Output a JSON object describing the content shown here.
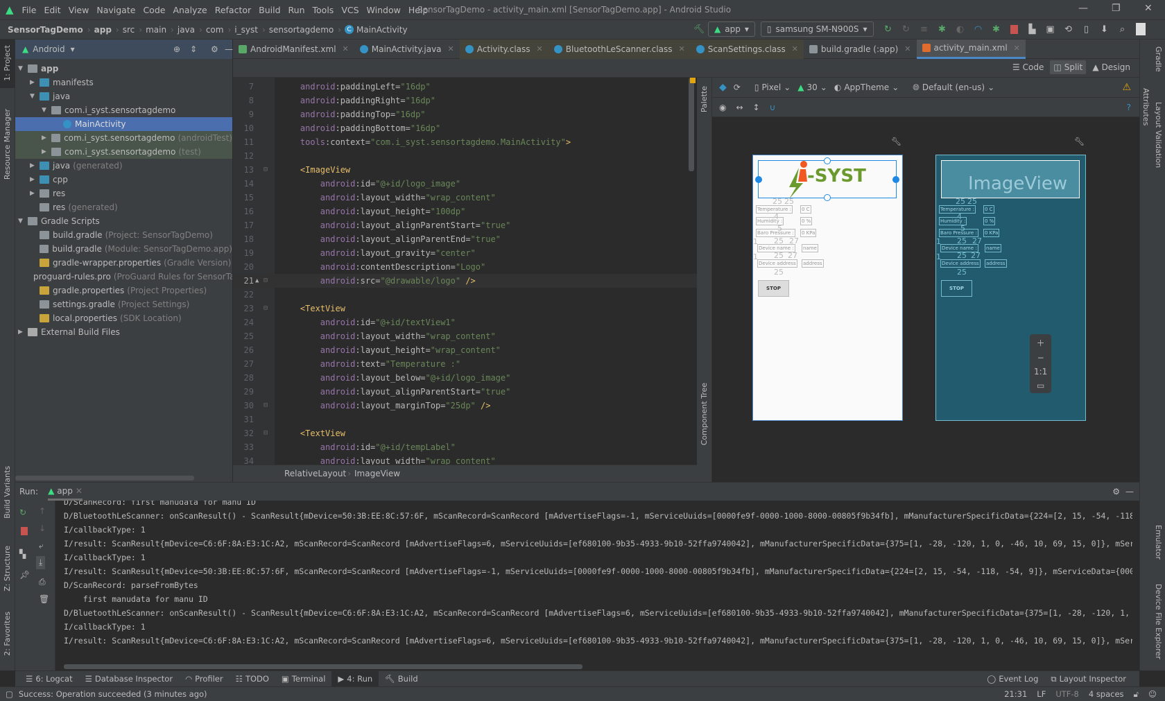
{
  "window": {
    "title": "SensorTagDemo - activity_main.xml [SensorTagDemo.app] - Android Studio"
  },
  "menu": [
    "File",
    "Edit",
    "View",
    "Navigate",
    "Code",
    "Analyze",
    "Refactor",
    "Build",
    "Run",
    "Tools",
    "VCS",
    "Window",
    "Help"
  ],
  "breadcrumb": [
    "SensorTagDemo",
    "app",
    "src",
    "main",
    "java",
    "com",
    "i_syst",
    "sensortagdemo",
    "MainActivity"
  ],
  "toolbar": {
    "run_config": "app",
    "device": "samsung SM-N900S"
  },
  "project": {
    "view_label": "Android",
    "items": [
      {
        "label": "app",
        "hint": "",
        "depth": 0,
        "arrow": "down",
        "icon": "module-folder",
        "bold": true
      },
      {
        "label": "manifests",
        "hint": "",
        "depth": 1,
        "arrow": "right",
        "icon": "folder"
      },
      {
        "label": "java",
        "hint": "",
        "depth": 1,
        "arrow": "down",
        "icon": "folder"
      },
      {
        "label": "com.i_syst.sensortagdemo",
        "hint": "",
        "depth": 2,
        "arrow": "down",
        "icon": "package"
      },
      {
        "label": "MainActivity",
        "hint": "",
        "depth": 3,
        "arrow": "",
        "icon": "class",
        "state": "sel"
      },
      {
        "label": "com.i_syst.sensortagdemo",
        "hint": "(androidTest)",
        "depth": 2,
        "arrow": "right",
        "icon": "package",
        "state": "test"
      },
      {
        "label": "com.i_syst.sensortagdemo",
        "hint": "(test)",
        "depth": 2,
        "arrow": "right",
        "icon": "package",
        "state": "test"
      },
      {
        "label": "java",
        "hint": "(generated)",
        "depth": 1,
        "arrow": "right",
        "icon": "folder"
      },
      {
        "label": "cpp",
        "hint": "",
        "depth": 1,
        "arrow": "right",
        "icon": "folder"
      },
      {
        "label": "res",
        "hint": "",
        "depth": 1,
        "arrow": "right",
        "icon": "res-folder"
      },
      {
        "label": "res",
        "hint": "(generated)",
        "depth": 1,
        "arrow": "",
        "icon": "res-folder"
      },
      {
        "label": "Gradle Scripts",
        "hint": "",
        "depth": 0,
        "arrow": "down",
        "icon": "gradle"
      },
      {
        "label": "build.gradle",
        "hint": "(Project: SensorTagDemo)",
        "depth": 1,
        "arrow": "",
        "icon": "gradle"
      },
      {
        "label": "build.gradle",
        "hint": "(Module: SensorTagDemo.app)",
        "depth": 1,
        "arrow": "",
        "icon": "gradle"
      },
      {
        "label": "gradle-wrapper.properties",
        "hint": "(Gradle Version)",
        "depth": 1,
        "arrow": "",
        "icon": "properties"
      },
      {
        "label": "proguard-rules.pro",
        "hint": "(ProGuard Rules for SensorTa",
        "depth": 1,
        "arrow": "",
        "icon": "file"
      },
      {
        "label": "gradle.properties",
        "hint": "(Project Properties)",
        "depth": 1,
        "arrow": "",
        "icon": "properties"
      },
      {
        "label": "settings.gradle",
        "hint": "(Project Settings)",
        "depth": 1,
        "arrow": "",
        "icon": "gradle"
      },
      {
        "label": "local.properties",
        "hint": "(SDK Location)",
        "depth": 1,
        "arrow": "",
        "icon": "properties"
      },
      {
        "label": "External Build Files",
        "hint": "",
        "depth": 0,
        "arrow": "right",
        "icon": "tools"
      }
    ]
  },
  "tabs": [
    {
      "label": "AndroidManifest.xml",
      "icon": "manifest"
    },
    {
      "label": "MainActivity.java",
      "icon": "class"
    },
    {
      "label": "Activity.class",
      "icon": "class-lib",
      "lib": true
    },
    {
      "label": "BluetoothLeScanner.class",
      "icon": "class-lib",
      "lib": true
    },
    {
      "label": "ScanSettings.class",
      "icon": "class-lib",
      "lib": true
    },
    {
      "label": "build.gradle (:app)",
      "icon": "gradle"
    },
    {
      "label": "activity_main.xml",
      "icon": "layout-xml",
      "active": true
    }
  ],
  "view_modes": [
    "Code",
    "Split",
    "Design"
  ],
  "active_view_mode": "Split",
  "editor": {
    "current_line": 21,
    "lines": [
      {
        "n": 7,
        "seg": [
          [
            "ns",
            "    android"
          ],
          [
            "at",
            ":paddingLeft="
          ],
          [
            "str",
            "\"16dp\""
          ]
        ]
      },
      {
        "n": 8,
        "seg": [
          [
            "ns",
            "    android"
          ],
          [
            "at",
            ":paddingRight="
          ],
          [
            "str",
            "\"16dp\""
          ]
        ]
      },
      {
        "n": 9,
        "seg": [
          [
            "ns",
            "    android"
          ],
          [
            "at",
            ":paddingTop="
          ],
          [
            "str",
            "\"16dp\""
          ]
        ]
      },
      {
        "n": 10,
        "seg": [
          [
            "ns",
            "    android"
          ],
          [
            "at",
            ":paddingBottom="
          ],
          [
            "str",
            "\"16dp\""
          ]
        ]
      },
      {
        "n": 11,
        "seg": [
          [
            "ns",
            "    tools"
          ],
          [
            "at",
            ":context="
          ],
          [
            "str",
            "\"com.i_syst.sensortagdemo.MainActivity\""
          ],
          [
            "tag",
            ">"
          ]
        ]
      },
      {
        "n": 12,
        "seg": []
      },
      {
        "n": 13,
        "seg": [
          [
            "tag",
            "    <ImageView"
          ]
        ]
      },
      {
        "n": 14,
        "seg": [
          [
            "ns",
            "        android"
          ],
          [
            "at",
            ":id="
          ],
          [
            "str",
            "\"@+id/logo_image\""
          ]
        ]
      },
      {
        "n": 15,
        "seg": [
          [
            "ns",
            "        android"
          ],
          [
            "at",
            ":layout_width="
          ],
          [
            "str",
            "\"wrap_content\""
          ]
        ]
      },
      {
        "n": 16,
        "seg": [
          [
            "ns",
            "        android"
          ],
          [
            "at",
            ":layout_height="
          ],
          [
            "str",
            "\"100dp\""
          ]
        ]
      },
      {
        "n": 17,
        "seg": [
          [
            "ns",
            "        android"
          ],
          [
            "at",
            ":layout_alignParentStart="
          ],
          [
            "str",
            "\"true\""
          ]
        ]
      },
      {
        "n": 18,
        "seg": [
          [
            "ns",
            "        android"
          ],
          [
            "at",
            ":layout_alignParentEnd="
          ],
          [
            "str",
            "\"true\""
          ]
        ]
      },
      {
        "n": 19,
        "seg": [
          [
            "ns",
            "        android"
          ],
          [
            "at",
            ":layout_gravity="
          ],
          [
            "str",
            "\"center\""
          ]
        ]
      },
      {
        "n": 20,
        "seg": [
          [
            "ns",
            "        android"
          ],
          [
            "at",
            ":contentDescription="
          ],
          [
            "str",
            "\"Logo\""
          ]
        ]
      },
      {
        "n": 21,
        "seg": [
          [
            "ns",
            "        android"
          ],
          [
            "at",
            ":src="
          ],
          [
            "str",
            "\"@drawable/logo\""
          ],
          [
            "tag",
            " />"
          ]
        ]
      },
      {
        "n": 22,
        "seg": []
      },
      {
        "n": 23,
        "seg": [
          [
            "tag",
            "    <TextView"
          ]
        ]
      },
      {
        "n": 24,
        "seg": [
          [
            "ns",
            "        android"
          ],
          [
            "at",
            ":id="
          ],
          [
            "str",
            "\"@+id/textView1\""
          ]
        ]
      },
      {
        "n": 25,
        "seg": [
          [
            "ns",
            "        android"
          ],
          [
            "at",
            ":layout_width="
          ],
          [
            "str",
            "\"wrap_content\""
          ]
        ]
      },
      {
        "n": 26,
        "seg": [
          [
            "ns",
            "        android"
          ],
          [
            "at",
            ":layout_height="
          ],
          [
            "str",
            "\"wrap_content\""
          ]
        ]
      },
      {
        "n": 27,
        "seg": [
          [
            "ns",
            "        android"
          ],
          [
            "at",
            ":text="
          ],
          [
            "str",
            "\"Temperature :\""
          ]
        ]
      },
      {
        "n": 28,
        "seg": [
          [
            "ns",
            "        android"
          ],
          [
            "at",
            ":layout_below="
          ],
          [
            "str",
            "\"@+id/logo_image\""
          ]
        ]
      },
      {
        "n": 29,
        "seg": [
          [
            "ns",
            "        android"
          ],
          [
            "at",
            ":layout_alignParentStart="
          ],
          [
            "str",
            "\"true\""
          ]
        ]
      },
      {
        "n": 30,
        "seg": [
          [
            "ns",
            "        android"
          ],
          [
            "at",
            ":layout_marginTop="
          ],
          [
            "str",
            "\"25dp\""
          ],
          [
            "tag",
            " />"
          ]
        ]
      },
      {
        "n": 31,
        "seg": []
      },
      {
        "n": 32,
        "seg": [
          [
            "tag",
            "    <TextView"
          ]
        ]
      },
      {
        "n": 33,
        "seg": [
          [
            "ns",
            "        android"
          ],
          [
            "at",
            ":id="
          ],
          [
            "str",
            "\"@+id/tempLabel\""
          ]
        ]
      },
      {
        "n": 34,
        "seg": [
          [
            "ns",
            "        android"
          ],
          [
            "at",
            ":layout_width="
          ],
          [
            "str",
            "\"wrap_content\""
          ]
        ]
      }
    ]
  },
  "editor_breadcrumb": [
    "RelativeLayout",
    "ImageView"
  ],
  "design": {
    "palette_label": "Palette",
    "component_tree_label": "Component Tree",
    "device": "Pixel",
    "api": "30",
    "theme": "AppTheme",
    "locale": "Default (en-us)",
    "logo_text": "i-SYST",
    "imageview_label": "ImageView",
    "widgets": {
      "temp_label": "Temperature :",
      "temp_value": "0 C",
      "hum_label": "Humidity :",
      "hum_value": "0 %",
      "baro_label": "Baro Pressure :",
      "baro_value": "0 KPa",
      "name_label": "Device name :",
      "name_value": "name",
      "addr_label": "Device address",
      "addr_value": "address",
      "stop": "STOP"
    },
    "margins": [
      "25",
      "25",
      "4",
      "5",
      "25",
      "27",
      "25",
      "27",
      "25",
      "1",
      "1"
    ],
    "zoom_fit": "1:1"
  },
  "right_strip": [
    "Gradle",
    "Layout Validation",
    "Attributes",
    "Emulator",
    "Device File Explorer"
  ],
  "left_strip": [
    "1: Project",
    "Resource Manager",
    "Build Variants",
    "Z: Structure",
    "2: Favorites"
  ],
  "run": {
    "label": "Run:",
    "tab": "app",
    "log": [
      "D/ScanRecord: first manudata for manu ID",
      "D/BluetoothLeScanner: onScanResult() - ScanResult{mDevice=50:3B:EE:8C:57:6F, mScanRecord=ScanRecord [mAdvertiseFlags=-1, mServiceUuids=[0000fe9f-0000-1000-8000-00805f9b34fb], mManufacturerSpecificData={224=[2, 15, -54, -118,",
      "I/callbackType: 1",
      "I/result: ScanResult{mDevice=C6:6F:8A:E3:1C:A2, mScanRecord=ScanRecord [mAdvertiseFlags=6, mServiceUuids=[ef680100-9b35-4933-9b10-52ffa9740042], mManufacturerSpecificData={375=[1, -28, -120, 1, 0, -46, 10, 69, 15, 0]}, mServ",
      "I/callbackType: 1",
      "I/result: ScanResult{mDevice=50:3B:EE:8C:57:6F, mScanRecord=ScanRecord [mAdvertiseFlags=-1, mServiceUuids=[0000fe9f-0000-1000-8000-00805f9b34fb], mManufacturerSpecificData={224=[2, 15, -54, -118, -54, 9]}, mServiceData={0000",
      "D/ScanRecord: parseFromBytes",
      "    first manudata for manu ID",
      "D/BluetoothLeScanner: onScanResult() - ScanResult{mDevice=C6:6F:8A:E3:1C:A2, mScanRecord=ScanRecord [mAdvertiseFlags=6, mServiceUuids=[ef680100-9b35-4933-9b10-52ffa9740042], mManufacturerSpecificData={375=[1, -28, -120, 1, 0",
      "I/callbackType: 1",
      "I/result: ScanResult{mDevice=C6:6F:8A:E3:1C:A2, mScanRecord=ScanRecord [mAdvertiseFlags=6, mServiceUuids=[ef680100-9b35-4933-9b10-52ffa9740042], mManufacturerSpecificData={375=[1, -28, -120, 1, 0, -46, 10, 69, 15, 0]}, mServ"
    ]
  },
  "bottom_tabs": [
    {
      "label": "6: Logcat",
      "icon": "logcat"
    },
    {
      "label": "Database Inspector",
      "icon": "database"
    },
    {
      "label": "Profiler",
      "icon": "profiler"
    },
    {
      "label": "TODO",
      "icon": "todo"
    },
    {
      "label": "Terminal",
      "icon": "terminal"
    },
    {
      "label": "4: Run",
      "icon": "run",
      "active": true
    },
    {
      "label": "Build",
      "icon": "hammer"
    }
  ],
  "bottom_right_tabs": [
    {
      "label": "Event Log",
      "icon": "event-log"
    },
    {
      "label": "Layout Inspector",
      "icon": "layout-inspector"
    }
  ],
  "status": {
    "message": "Success: Operation succeeded (3 minutes ago)",
    "position": "21:31",
    "line_sep": "LF",
    "encoding": "UTF-8",
    "indent": "4 spaces"
  },
  "colors": {
    "android_green": "#3ddc84",
    "selection": "#4b6eaf",
    "accent_blue": "#4a88c7",
    "stop_red": "#c75450",
    "blueprint": "#235b6e"
  }
}
